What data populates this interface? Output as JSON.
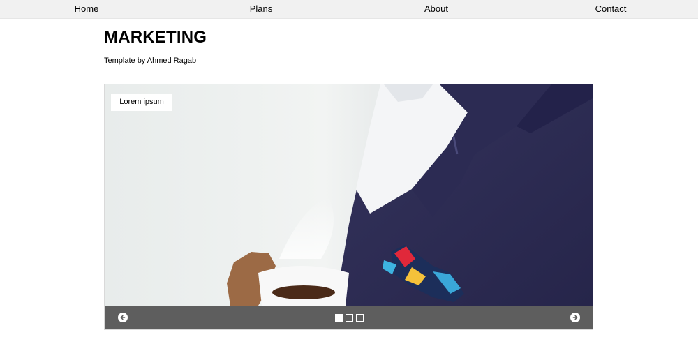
{
  "nav": {
    "home": "Home",
    "plans": "Plans",
    "about": "About",
    "contact": "Contact"
  },
  "header": {
    "title": "MARKETING",
    "subtitle": "Template by Ahmed Ragab"
  },
  "slider": {
    "caption": "Lorem ipsum",
    "slide_count": 3,
    "active_slide": 1,
    "prev_icon": "arrow-left-circle-icon",
    "next_icon": "arrow-right-circle-icon"
  },
  "colors": {
    "nav_bg": "#f1f1f1",
    "controls_bg": "#5e5e5e",
    "suit": "#2f2e54"
  }
}
